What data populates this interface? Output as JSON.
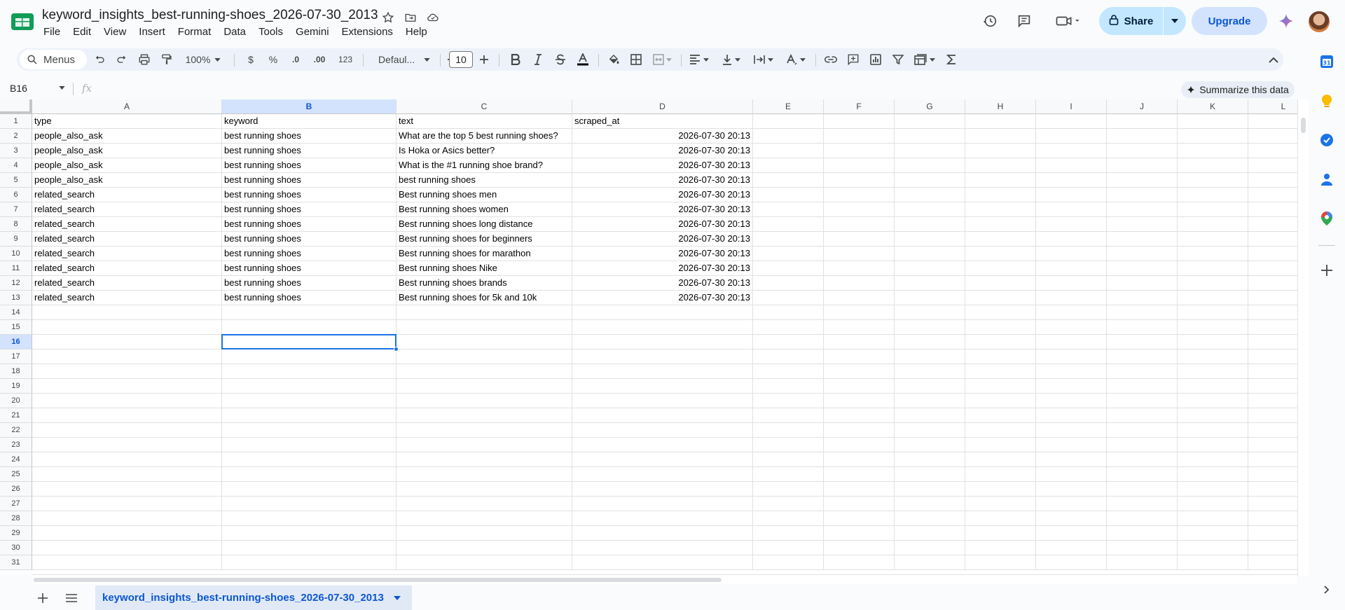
{
  "doc": {
    "title": "keyword_insights_best-running-shoes_2026-07-30_2013"
  },
  "menu": [
    "File",
    "Edit",
    "View",
    "Insert",
    "Format",
    "Data",
    "Tools",
    "Gemini",
    "Extensions",
    "Help"
  ],
  "header": {
    "share_label": "Share",
    "upgrade_label": "Upgrade"
  },
  "toolbar": {
    "search_label": "Menus",
    "zoom": "100%",
    "currency": "$",
    "percent": "%",
    "dec_decrease": ".0",
    "dec_increase": ".00",
    "number_format": "123",
    "font": "Defaul...",
    "font_size": "10"
  },
  "formula_bar": {
    "name_box": "B16",
    "fx": "fx",
    "summarize_label": "Summarize this data"
  },
  "grid": {
    "columns": [
      "A",
      "B",
      "C",
      "D",
      "E",
      "F",
      "G",
      "H",
      "I",
      "J",
      "K",
      "L"
    ],
    "selected_column": "B",
    "selected_row": 16,
    "row_numbers": [
      "1",
      "2",
      "3",
      "4",
      "5",
      "6",
      "7",
      "8",
      "9",
      "10",
      "11",
      "12",
      "13",
      "14",
      "15",
      "16",
      "17",
      "18",
      "19",
      "20",
      "21",
      "22",
      "23",
      "24",
      "25",
      "26",
      "27",
      "28",
      "29",
      "30",
      "31"
    ],
    "rows": [
      [
        "type",
        "keyword",
        "text",
        "scraped_at"
      ],
      [
        "people_also_ask",
        "best running shoes",
        "What are the top 5 best running shoes?",
        "2026-07-30 20:13"
      ],
      [
        "people_also_ask",
        "best running shoes",
        "Is Hoka or Asics better?",
        "2026-07-30 20:13"
      ],
      [
        "people_also_ask",
        "best running shoes",
        "What is the #1 running shoe brand?",
        "2026-07-30 20:13"
      ],
      [
        "people_also_ask",
        "best running shoes",
        "best running shoes",
        "2026-07-30 20:13"
      ],
      [
        "related_search",
        "best running shoes",
        "Best running shoes men",
        "2026-07-30 20:13"
      ],
      [
        "related_search",
        "best running shoes",
        "Best running shoes women",
        "2026-07-30 20:13"
      ],
      [
        "related_search",
        "best running shoes",
        "Best running shoes long distance",
        "2026-07-30 20:13"
      ],
      [
        "related_search",
        "best running shoes",
        "Best running shoes for beginners",
        "2026-07-30 20:13"
      ],
      [
        "related_search",
        "best running shoes",
        "Best running shoes for marathon",
        "2026-07-30 20:13"
      ],
      [
        "related_search",
        "best running shoes",
        "Best running shoes Nike",
        "2026-07-30 20:13"
      ],
      [
        "related_search",
        "best running shoes",
        "Best running shoes brands",
        "2026-07-30 20:13"
      ],
      [
        "related_search",
        "best running shoes",
        "Best running shoes for 5k and 10k",
        "2026-07-30 20:13"
      ]
    ]
  },
  "sheets": {
    "active_tab": "keyword_insights_best-running-shoes_2026-07-30_2013"
  },
  "colors": {
    "accent": "#0b57d0",
    "selection": "#1a73e8",
    "share_bg": "#c2e7ff",
    "upgrade_bg": "#d3e3fd"
  }
}
